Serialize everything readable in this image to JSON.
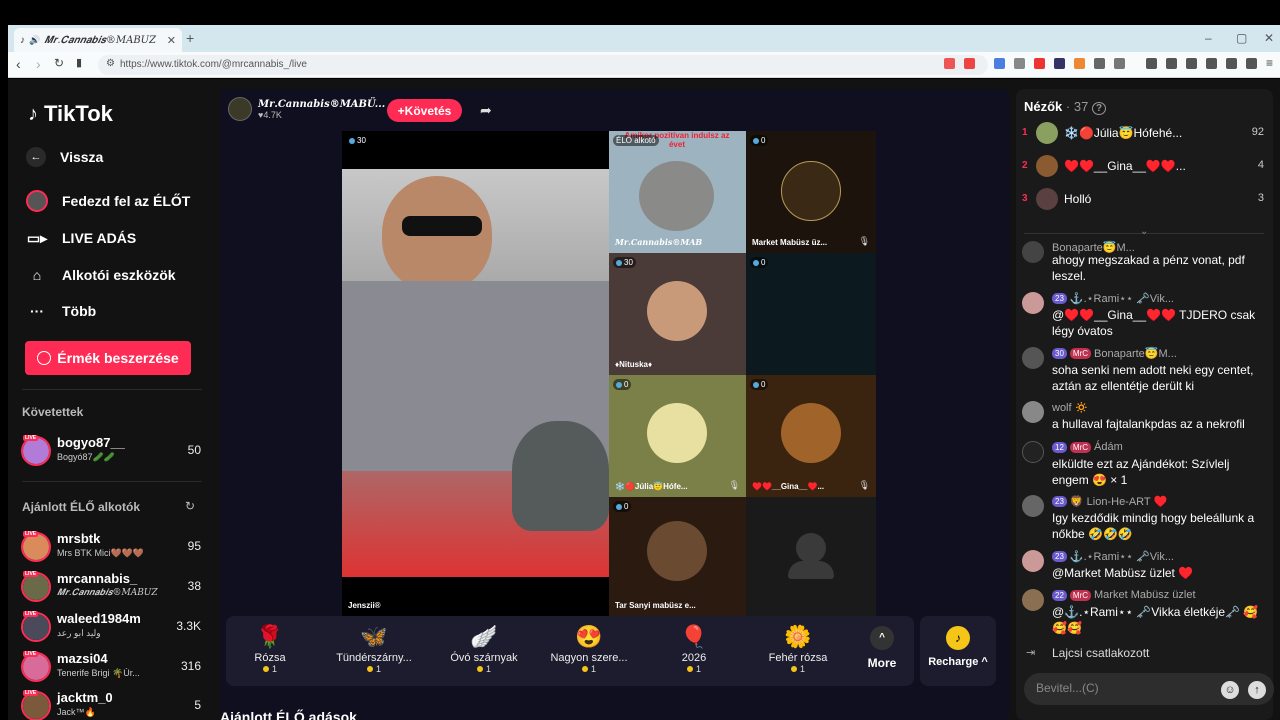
{
  "browser": {
    "tab_title": "𝑴𝒓.𝑪𝒂𝒏𝒏𝒂𝒃𝒊𝒔®MABÜZ",
    "url": "https://www.tiktok.com/@mrcannabis_/live"
  },
  "sidebar": {
    "logo": "TikTok",
    "back": "Vissza",
    "nav": [
      {
        "label": "Fedezd fel az ÉLŐT",
        "icon": "avatar-icon"
      },
      {
        "label": "LIVE ADÁS",
        "icon": "camera-icon"
      },
      {
        "label": "Alkotói eszközök",
        "icon": "creator-tools-icon"
      },
      {
        "label": "Több",
        "icon": "more-dots-icon"
      }
    ],
    "coins_button": "Érmék beszerzése",
    "following_header": "Követettek",
    "following": [
      {
        "name": "bogyo87__",
        "sub": "Bogyó87🥒🥒",
        "count": "50",
        "color": "#b37bd8"
      }
    ],
    "recommended_header": "Ajánlott ÉLŐ alkotók",
    "recommended": [
      {
        "name": "mrsbtk",
        "sub": "Mrs BTK Mici🤎🤎🤎",
        "count": "95",
        "color": "#d98b5c"
      },
      {
        "name": "mrcannabis_",
        "sub": "𝑴𝒓.𝑪𝒂𝒏𝒏𝒂𝒃𝒊𝒔®MABÜZ",
        "count": "38",
        "color": "#6a6a48"
      },
      {
        "name": "waleed1984m",
        "sub": "وليد ابو رعد",
        "count": "3.3K",
        "color": "#4a4a5a"
      },
      {
        "name": "mazsi04",
        "sub": "Tenerife Brigi 🌴Úr...",
        "count": "316",
        "color": "#d86b9a"
      },
      {
        "name": "jacktm_0",
        "sub": "Jack™🔥",
        "count": "5",
        "color": "#7a5a3a"
      }
    ]
  },
  "main": {
    "host_name": "𝑴𝒓.𝑪𝒂𝒏𝒏𝒂𝒃𝒊𝒔®MABÜ...",
    "host_likes": "♥4.7K",
    "follow_button": "+Követés",
    "cells": [
      {
        "badge": "30",
        "caption": "Jenszii®"
      },
      {
        "badge": "ÉLŐ alkotó",
        "caption": "𝑴𝒓.𝑪𝒂𝒏𝒏𝒂𝒃𝒊𝒔®MAB",
        "overlay": "Amikor pozitívan indulsz az évet"
      },
      {
        "badge": "0",
        "caption": "Market Mabüsz üz..."
      },
      {
        "badge": "30",
        "caption": "♦Nituska♦"
      },
      {
        "badge": "0",
        "caption": ""
      },
      {
        "badge": "0",
        "caption": "❄️🔴Júlia😇Hófe..."
      },
      {
        "badge": "0",
        "caption": "♥️♥️__Gina__♥️..."
      },
      {
        "badge": "0",
        "caption": "Tar Sanyi mabüsz e..."
      },
      {
        "badge": "",
        "caption": ""
      }
    ],
    "gifts": [
      {
        "emoji": "🌹",
        "name": "Rózsa",
        "price": "1"
      },
      {
        "emoji": "🦋",
        "name": "Tündérszárny...",
        "price": "1"
      },
      {
        "emoji": "🪽",
        "name": "Óvó szárnyak",
        "price": "1"
      },
      {
        "emoji": "😍",
        "name": "Nagyon szere...",
        "price": "1"
      },
      {
        "emoji": "🎈",
        "name": "2026",
        "price": "1"
      },
      {
        "emoji": "🌼",
        "name": "Fehér rózsa",
        "price": "1"
      }
    ],
    "more": "More",
    "recharge": "Recharge ^",
    "recommended_section": "Ajánlott ÉLŐ adások"
  },
  "viewers": {
    "title": "Nézők",
    "count": "· 37",
    "top": [
      {
        "rank": "1",
        "name": "❄️🔴Júlia😇Hófehé...",
        "score": "92",
        "color": "#8aa060"
      },
      {
        "rank": "2",
        "name": "♥️♥️__Gina__♥️♥️...",
        "score": "4",
        "color": "#8a5a30"
      },
      {
        "rank": "3",
        "name": "Holló",
        "score": "3",
        "color": "#5a4040"
      }
    ]
  },
  "chat": [
    {
      "head": "Bonaparte😇M...",
      "tags": [],
      "text": "ahogy megszakad a pénz vonat, pdf leszel.",
      "color": "#444"
    },
    {
      "head": "⚓.⋆Rami⋆⋆ 🗝️Vik...",
      "tags": [
        "23"
      ],
      "text": "@♥️♥️__Gina__♥️♥️ TJDERO csak légy óvatos",
      "color": "#c99"
    },
    {
      "head": "Bonaparte😇M...",
      "tags": [
        "30",
        "MrC"
      ],
      "text": "soha senki nem adott neki egy centet, aztán az ellentétje derült ki",
      "color": "#555"
    },
    {
      "head": "wolf 🔅",
      "tags": [],
      "text": "a hullaval fajtalankpdas az a nekrofil",
      "color": "#888"
    },
    {
      "head": "Ádám",
      "tags": [
        "12",
        "MrC"
      ],
      "text": "elküldte ezt az Ajándékot: Szívlelj engem 😍 × 1",
      "color": "#222"
    },
    {
      "head": "🦁 Lion-He-ART ♥️",
      "tags": [
        "23"
      ],
      "text": "Igy kezdődik mindig hogy beleállunk a nőkbe 🤣🤣🤣",
      "color": "#666"
    },
    {
      "head": "⚓.⋆Rami⋆⋆ 🗝️Vik...",
      "tags": [
        "23"
      ],
      "text": "@Market Mabüsz üzlet ♥️",
      "color": "#c99"
    },
    {
      "head": "Market Mabüsz üzlet",
      "tags": [
        "22",
        "MrC"
      ],
      "text": "@⚓.⋆Rami⋆⋆ 🗝️Vikka életkéje🗝️ 🥰🥰🥰",
      "color": "#8a7050"
    },
    {
      "head": "Lajcsi csatlakozott",
      "tags": [],
      "text": "",
      "color": "#333"
    }
  ],
  "input_placeholder": "Bevitel...(C)"
}
